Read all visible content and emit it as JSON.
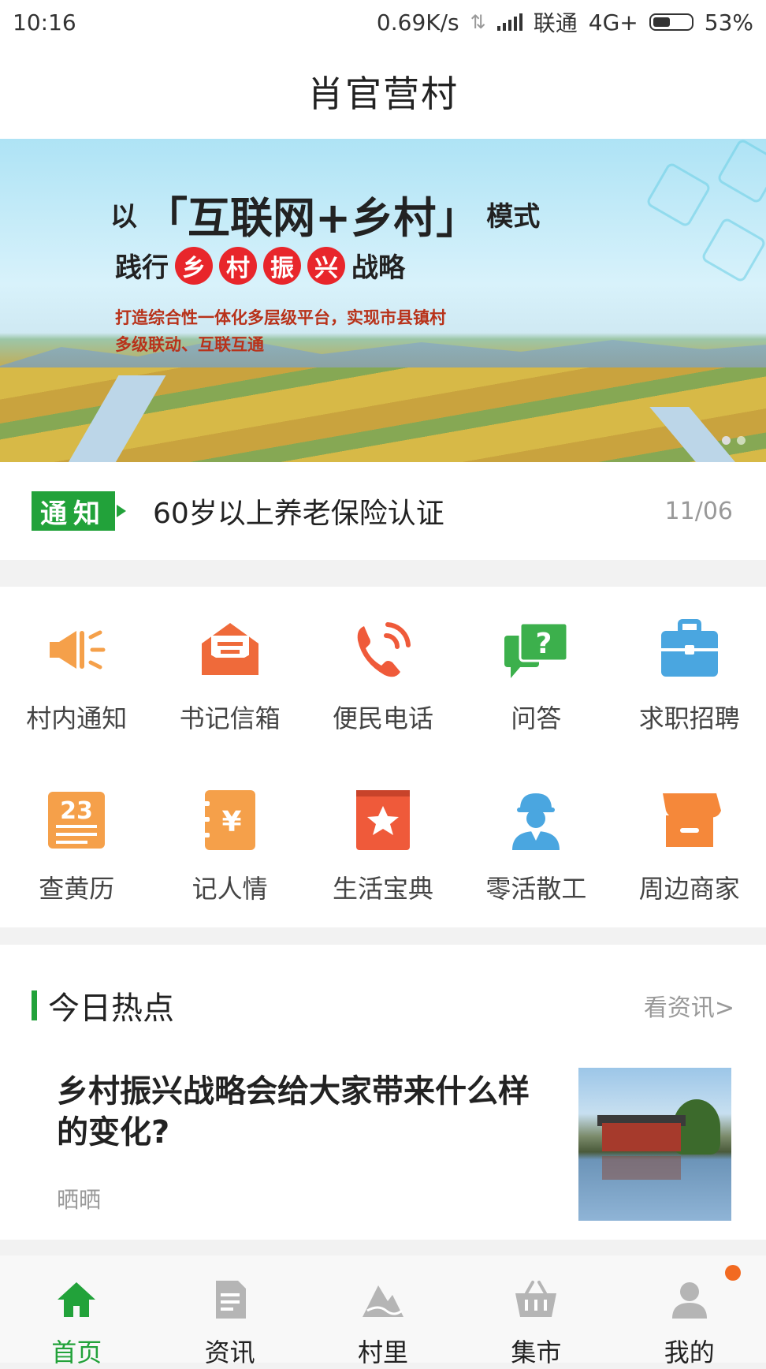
{
  "status_bar": {
    "time": "10:16",
    "speed": "0.69K/s",
    "carrier": "联通",
    "network": "4G+",
    "battery": "53%",
    "battery_level": 0.53
  },
  "header": {
    "title": "肖官营村"
  },
  "banner": {
    "line1_prefix": "以",
    "line1_highlight": "「互联网+乡村」",
    "line1_suffix": "模式",
    "line2_prefix": "践行",
    "line2_circles": [
      "乡",
      "村",
      "振",
      "兴"
    ],
    "line2_suffix": "战略",
    "line3": "打造综合性一体化多层级平台，实现市县镇村",
    "line4": "多级联动、互联互通"
  },
  "notice": {
    "tag": "通知",
    "text": "60岁以上养老保险认证",
    "date": "11/06"
  },
  "services": [
    {
      "label": "村内通知",
      "icon": "megaphone-icon",
      "color": "#f5a04a"
    },
    {
      "label": "书记信箱",
      "icon": "envelope-icon",
      "color": "#ef6a3a"
    },
    {
      "label": "便民电话",
      "icon": "phone-icon",
      "color": "#ef5a3a"
    },
    {
      "label": "问答",
      "icon": "qa-bubble-icon",
      "color": "#3cb04c"
    },
    {
      "label": "求职招聘",
      "icon": "briefcase-icon",
      "color": "#4aa6e0"
    },
    {
      "label": "查黄历",
      "icon": "calendar-icon",
      "color": "#f5a04a"
    },
    {
      "label": "记人情",
      "icon": "yen-book-icon",
      "color": "#f5a04a"
    },
    {
      "label": "生活宝典",
      "icon": "star-book-icon",
      "color": "#ef5a3a"
    },
    {
      "label": "零活散工",
      "icon": "worker-icon",
      "color": "#4aa6e0"
    },
    {
      "label": "周边商家",
      "icon": "shop-icon",
      "color": "#f5883a"
    }
  ],
  "hot": {
    "title": "今日热点",
    "more": "看资讯>",
    "article": {
      "title": "乡村振兴战略会给大家带来什么样的变化?",
      "source": "晒晒"
    }
  },
  "tabs": [
    {
      "label": "首页",
      "icon": "home-icon",
      "active": true
    },
    {
      "label": "资讯",
      "icon": "document-icon",
      "active": false
    },
    {
      "label": "村里",
      "icon": "mountain-icon",
      "active": false
    },
    {
      "label": "集市",
      "icon": "basket-icon",
      "active": false
    },
    {
      "label": "我的",
      "icon": "user-icon",
      "active": false,
      "badge": true
    }
  ],
  "colors": {
    "accent": "#22a23a",
    "badge": "#f26a21"
  }
}
